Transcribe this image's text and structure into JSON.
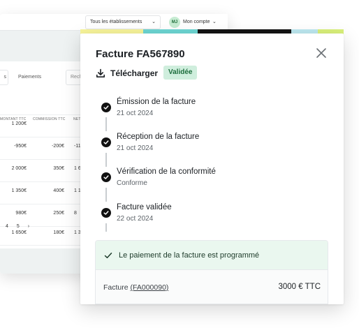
{
  "background_app": {
    "establishment_select": {
      "value": "Tous les établissements"
    },
    "account": {
      "avatar_initials": "MJ",
      "label": "Mon compte"
    },
    "tabs": [
      {
        "label": "s"
      },
      {
        "label": "Paiements"
      }
    ],
    "search": {
      "placeholder": "Rech"
    },
    "table": {
      "headers": [
        "MONTANT TTC",
        "COMMISSION TTC",
        "NET"
      ],
      "rows": [
        {
          "amount": "1 200€",
          "commission": "",
          "net": ""
        },
        {
          "amount": "-950€",
          "commission": "-200€",
          "net": "-11"
        },
        {
          "amount": "2 000€",
          "commission": "350€",
          "net": "1 6"
        },
        {
          "amount": "1 350€",
          "commission": "400€",
          "net": "1 1"
        },
        {
          "amount": "980€",
          "commission": "250€",
          "net": "8"
        },
        {
          "amount": "1 650€",
          "commission": "180€",
          "net": "1 3"
        }
      ]
    },
    "pagination": [
      "4",
      "5",
      "›"
    ]
  },
  "decor_strip_colors": [
    "#f7f49a",
    "#6dd6d3",
    "#141414",
    "#bde8f0",
    "#d9f07a"
  ],
  "invoice": {
    "title": "Facture FA567890",
    "download_label": "Télécharger",
    "status": "Validée",
    "status_colors": {
      "background": "#cfeedd",
      "text": "#1c6d3c"
    },
    "timeline": [
      {
        "title": "Émission de la facture",
        "subtitle": "21 oct 2024"
      },
      {
        "title": "Réception de la facture",
        "subtitle": "21 oct 2024"
      },
      {
        "title": "Vérification de la conformité",
        "subtitle": "Conforme"
      },
      {
        "title": "Facture validée",
        "subtitle": "22 oct 2024"
      }
    ],
    "payment_banner": "Le paiement de la facture est programmé",
    "payment_row": {
      "label": "Facture",
      "invoice_ref": "(FA000090)",
      "amount": "3000 € TTC"
    }
  },
  "icons": {
    "close": "close-icon",
    "download": "download-icon",
    "step_done": "check-circle-icon",
    "banner": "check-icon",
    "select_chevron": "chevron-down-icon"
  }
}
